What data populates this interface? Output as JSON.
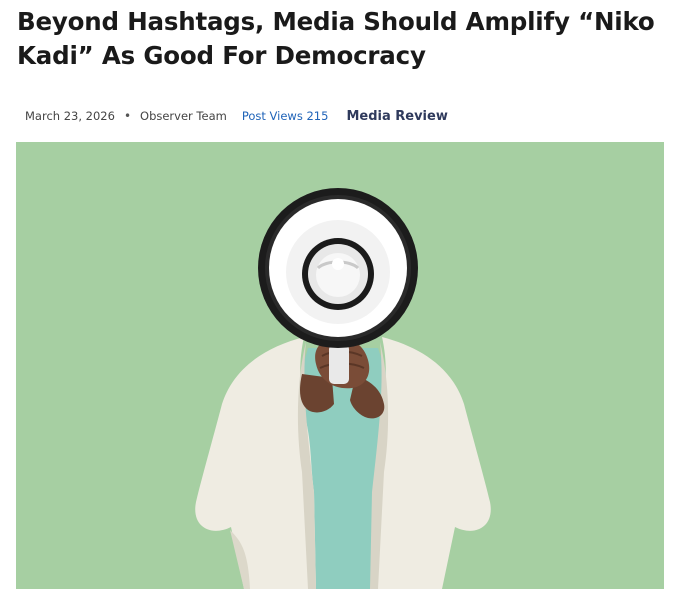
{
  "article": {
    "title": "Beyond Hashtags, Media Should Amplify “Niko Kadi” As Good For Democracy",
    "date": "March 23, 2026",
    "separator": "•",
    "author": "Observer Team",
    "post_views_label": "Post Views",
    "post_views_count": "215",
    "category": "Media Review"
  },
  "hero_image": {
    "subject": "person-holding-megaphone-over-face",
    "background_color": "#a6cfa2",
    "jacket_color": "#efece2",
    "shirt_color": "#8fcdbf",
    "megaphone_color": "#ffffff"
  }
}
